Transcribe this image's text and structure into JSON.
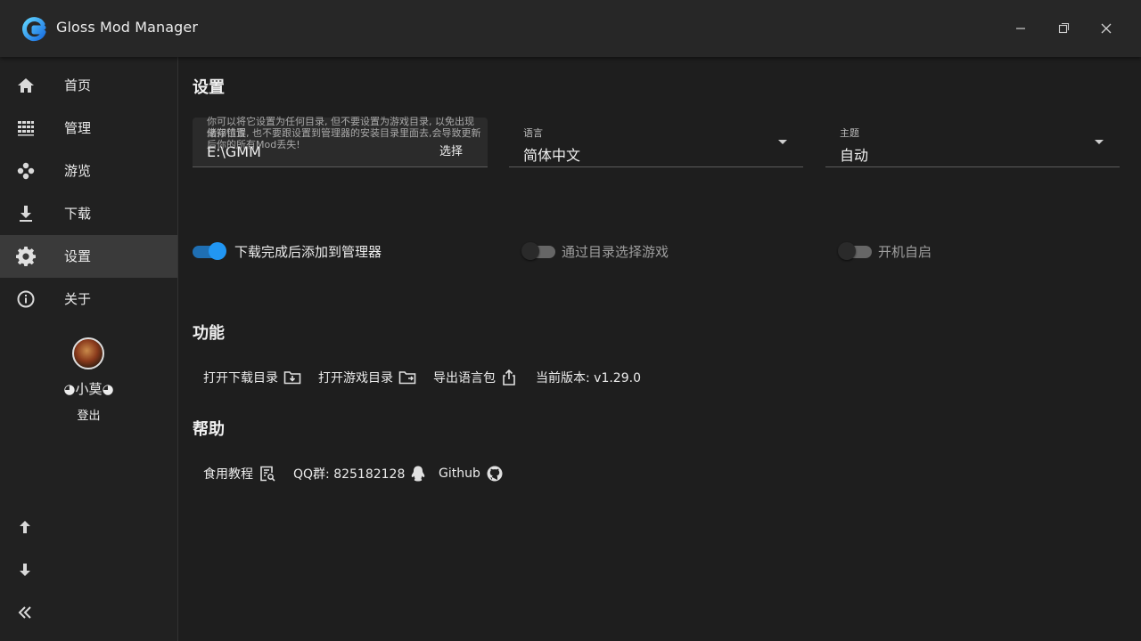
{
  "app": {
    "title": "Gloss Mod Manager",
    "accent_color": "#2196f3"
  },
  "window_controls": [
    "minimize-icon",
    "maximize-icon",
    "close-icon"
  ],
  "sidebar": {
    "items": [
      {
        "label": "首页",
        "icon": "home-icon"
      },
      {
        "label": "管理",
        "icon": "grid-icon"
      },
      {
        "label": "游览",
        "icon": "gamepad-icon"
      },
      {
        "label": "下载",
        "icon": "download-icon"
      },
      {
        "label": "设置",
        "icon": "gear-icon",
        "active": true
      },
      {
        "label": "关于",
        "icon": "info-icon"
      }
    ],
    "user": {
      "name": "◕小莫◕",
      "logout": "登出"
    },
    "bottom_buttons": [
      "arrow-up-icon",
      "arrow-down-icon",
      "collapse-icon"
    ]
  },
  "settings": {
    "title": "设置",
    "storage": {
      "label": "储存位置",
      "value": "E:\\GMM",
      "button": "选择",
      "hint": "你可以将它设置为任何目录, 但不要设置为游戏目录, 以免出现未知错误, 也不要跟设置到管理器的安装目录里面去,会导致更新后你的所有Mod丢失!"
    },
    "language": {
      "label": "语言",
      "value": "简体中文"
    },
    "theme": {
      "label": "主题",
      "value": "自动"
    },
    "switches": [
      {
        "label": "下载完成后添加到管理器",
        "on": true
      },
      {
        "label": "通过目录选择游戏",
        "on": false
      },
      {
        "label": "开机自启",
        "on": false
      }
    ]
  },
  "features": {
    "title": "功能",
    "open_download_dir": "打开下载目录",
    "open_game_dir": "打开游戏目录",
    "export_lang": "导出语言包",
    "version": "当前版本: v1.29.0"
  },
  "help": {
    "title": "帮助",
    "tutorial": "食用教程",
    "qq_group": "QQ群: 825182128",
    "github": "Github"
  }
}
